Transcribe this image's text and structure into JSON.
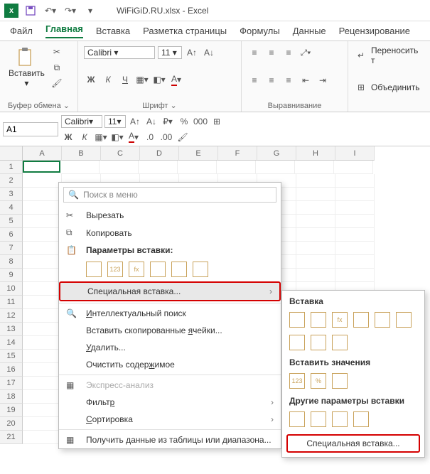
{
  "app": {
    "logo_letter": "x",
    "title": "WiFiGiD.RU.xlsx - Excel"
  },
  "qat": {
    "save_title": "Сохранить",
    "undo_title": "Отменить",
    "redo_title": "Повторить"
  },
  "tabs": {
    "file": "Файл",
    "home": "Главная",
    "insert": "Вставка",
    "layout": "Разметка страницы",
    "formulas": "Формулы",
    "data": "Данные",
    "review": "Рецензирование"
  },
  "ribbon": {
    "clipboard": {
      "paste": "Вставить",
      "group": "Буфер обмена"
    },
    "font": {
      "name": "Calibri",
      "size": "11",
      "bold": "Ж",
      "italic": "К",
      "underline": "Ч",
      "group": "Шрифт"
    },
    "align": {
      "wrap": "Переносить т",
      "merge": "Объединить",
      "group": "Выравнивание"
    }
  },
  "namebox": "A1",
  "minibar": {
    "font": "Calibri",
    "size": "11",
    "percent": "%",
    "thousands": "000"
  },
  "columns": [
    "A",
    "B",
    "C",
    "D",
    "E",
    "F",
    "G",
    "H",
    "I"
  ],
  "rows": [
    "1",
    "2",
    "3",
    "4",
    "5",
    "6",
    "7",
    "8",
    "9",
    "10",
    "11",
    "12",
    "13",
    "14",
    "15",
    "16",
    "17",
    "18",
    "19",
    "20",
    "21"
  ],
  "context": {
    "search_placeholder": "Поиск в меню",
    "cut": "Вырезать",
    "copy": "Копировать",
    "paste_options": "Параметры вставки:",
    "paste_special": "Специальная вставка...",
    "smart_lookup": "Интеллектуальный поиск",
    "insert_copied": "Вставить скопированные ячейки...",
    "delete": "Удалить...",
    "clear": "Очистить содержимое",
    "quick_analysis": "Экспресс-анализ",
    "filter": "Фильтр",
    "sort": "Сортировка",
    "get_table": "Получить данные из таблицы или диапазона...",
    "paste_icons": [
      "",
      "123",
      "fx",
      "",
      "",
      ""
    ]
  },
  "submenu": {
    "insert": "Вставка",
    "row1": [
      "",
      "",
      "fx",
      "",
      "",
      ""
    ],
    "row2": [
      "",
      "",
      ""
    ],
    "values": "Вставить значения",
    "row3": [
      "123",
      "%",
      ""
    ],
    "other": "Другие параметры вставки",
    "row4": [
      "",
      "",
      "",
      ""
    ],
    "special": "Специальная вставка..."
  }
}
